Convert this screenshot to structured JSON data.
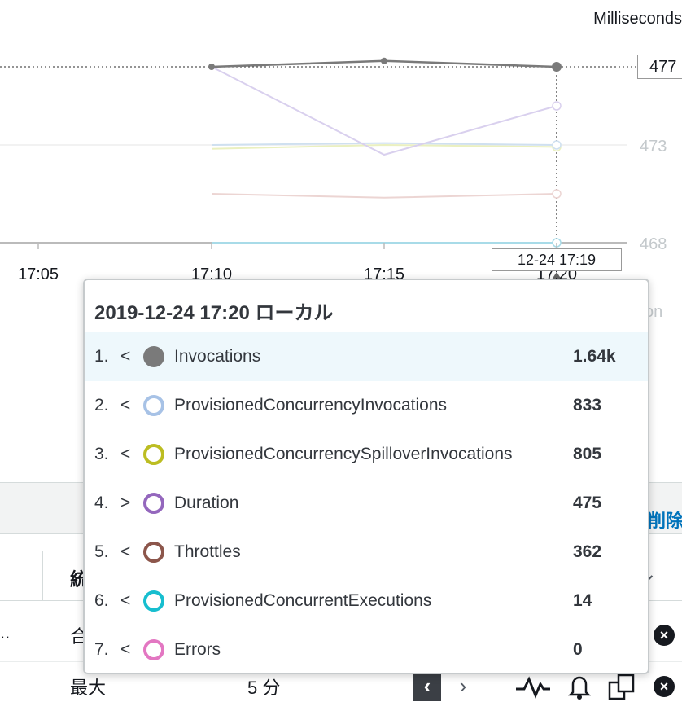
{
  "chart": {
    "y_axis_label": "Milliseconds",
    "y_ticks": [
      "473",
      "468"
    ],
    "x_ticks": [
      "17:05",
      "17:10",
      "17:15",
      "17:20"
    ],
    "hover_value": "477",
    "hover_time": "12-24 17:19",
    "faded_fragment": "on"
  },
  "chart_data": {
    "type": "line",
    "ylabel": "Milliseconds",
    "x": [
      "17:10",
      "17:15",
      "17:20"
    ],
    "ylim": [
      468,
      478
    ],
    "series": [
      {
        "values": [
          477.0,
          477.3,
          477.0
        ],
        "color": "#7a7a7a"
      },
      {
        "values": [
          477.0,
          472.5,
          475.0
        ],
        "color": "#d9d0ee"
      },
      {
        "values": [
          473.0,
          473.1,
          473.0
        ],
        "color": "#cfe0f0"
      },
      {
        "values": [
          472.8,
          473.0,
          472.9
        ],
        "color": "#eaf0c0"
      },
      {
        "values": [
          470.5,
          470.3,
          470.5
        ],
        "color": "#ecd5d3"
      },
      {
        "values": [
          468.0,
          468.0,
          468.0
        ],
        "color": "#a8dbe8"
      }
    ]
  },
  "tooltip": {
    "title": "2019-12-24 17:20 ローカル",
    "items": [
      {
        "num": "1.",
        "arrow": "<",
        "name": "Invocations",
        "value": "1.64k",
        "color": "#7a7a7a",
        "filled": true
      },
      {
        "num": "2.",
        "arrow": "<",
        "name": "ProvisionedConcurrencyInvocations",
        "value": "833",
        "color": "#a7c2e6",
        "filled": false
      },
      {
        "num": "3.",
        "arrow": "<",
        "name": "ProvisionedConcurrencySpilloverInvocations",
        "value": "805",
        "color": "#bcbd22",
        "filled": false
      },
      {
        "num": "4.",
        "arrow": ">",
        "name": "Duration",
        "value": "475",
        "color": "#9467bd",
        "filled": false
      },
      {
        "num": "5.",
        "arrow": "<",
        "name": "Throttles",
        "value": "362",
        "color": "#8c564b",
        "filled": false
      },
      {
        "num": "6.",
        "arrow": "<",
        "name": "ProvisionedConcurrentExecutions",
        "value": "14",
        "color": "#17becf",
        "filled": false
      },
      {
        "num": "7.",
        "arrow": "<",
        "name": "Errors",
        "value": "0",
        "color": "#e377c2",
        "filled": false
      }
    ]
  },
  "table": {
    "delete_label": "削除",
    "header_fragment": "統",
    "row1_fragment_left": "..",
    "row1_fragment": "合",
    "row2_stat": "最大",
    "row2_period": "5 分"
  }
}
